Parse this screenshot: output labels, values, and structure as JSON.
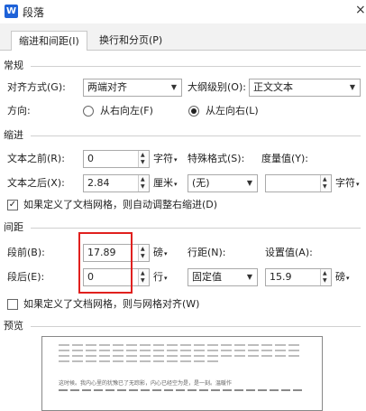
{
  "window": {
    "app_letter": "W",
    "title": "段落",
    "close": "×"
  },
  "tabs": [
    {
      "label": "缩进和间距(I)"
    },
    {
      "label": "换行和分页(P)"
    }
  ],
  "general": {
    "section": "常规",
    "alignment_label": "对齐方式(G):",
    "alignment_value": "两端对齐",
    "outline_label": "大纲级别(O):",
    "outline_value": "正文文本",
    "direction_label": "方向:",
    "rtl_label": "从右向左(F)",
    "ltr_label": "从左向右(L)"
  },
  "indent": {
    "section": "缩进",
    "before_label": "文本之前(R):",
    "before_value": "0",
    "before_unit": "字符",
    "after_label": "文本之后(X):",
    "after_value": "2.84",
    "after_unit": "厘米",
    "special_label": "特殊格式(S):",
    "special_value": "(无)",
    "measure_label": "度量值(Y):",
    "measure_value": "",
    "measure_unit": "字符",
    "auto_adjust_label": "如果定义了文档网格，则自动调整右缩进(D)"
  },
  "spacing": {
    "section": "间距",
    "before_label": "段前(B):",
    "before_value": "17.89",
    "before_unit": "磅",
    "after_label": "段后(E):",
    "after_value": "0",
    "after_unit": "行",
    "line_label": "行距(N):",
    "line_value": "固定值",
    "at_label": "设置值(A):",
    "at_value": "15.9",
    "at_unit": "磅",
    "snap_grid_label": "如果定义了文档网格，则与网格对齐(W)"
  },
  "preview": {
    "section": "预览",
    "sample_text": "这时候。我内心里的犹豫已了无踪影，内心已经空为是，是一刻。温暖作"
  },
  "glyphs": {
    "down_arrow": "▼",
    "caret": "▾",
    "spin_up": "▲",
    "spin_down": "▼",
    "check": "✓"
  }
}
